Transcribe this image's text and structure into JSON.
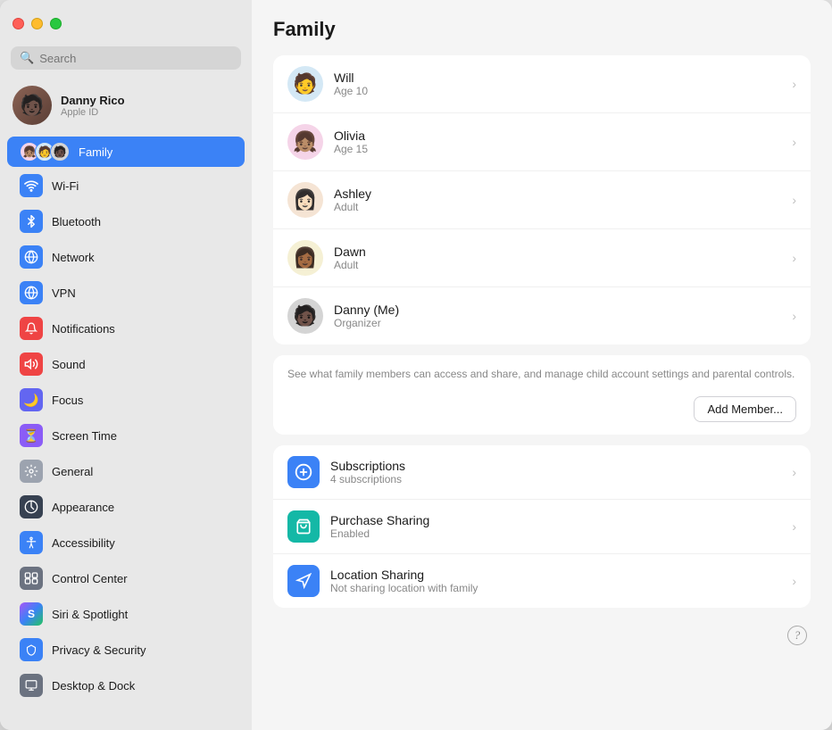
{
  "window": {
    "title": "Family"
  },
  "sidebar": {
    "search_placeholder": "Search",
    "user": {
      "name": "Danny Rico",
      "subtitle": "Apple ID",
      "emoji": "🧑🏿"
    },
    "items": [
      {
        "id": "family",
        "label": "Family",
        "icon": "family",
        "active": true
      },
      {
        "id": "wifi",
        "label": "Wi-Fi",
        "icon": "wifi"
      },
      {
        "id": "bluetooth",
        "label": "Bluetooth",
        "icon": "bluetooth"
      },
      {
        "id": "network",
        "label": "Network",
        "icon": "network"
      },
      {
        "id": "vpn",
        "label": "VPN",
        "icon": "vpn"
      },
      {
        "id": "notifications",
        "label": "Notifications",
        "icon": "notifications"
      },
      {
        "id": "sound",
        "label": "Sound",
        "icon": "sound"
      },
      {
        "id": "focus",
        "label": "Focus",
        "icon": "focus"
      },
      {
        "id": "screentime",
        "label": "Screen Time",
        "icon": "screentime"
      },
      {
        "id": "general",
        "label": "General",
        "icon": "general"
      },
      {
        "id": "appearance",
        "label": "Appearance",
        "icon": "appearance"
      },
      {
        "id": "accessibility",
        "label": "Accessibility",
        "icon": "accessibility"
      },
      {
        "id": "controlcenter",
        "label": "Control Center",
        "icon": "controlcenter"
      },
      {
        "id": "siri",
        "label": "Siri & Spotlight",
        "icon": "siri"
      },
      {
        "id": "privacy",
        "label": "Privacy & Security",
        "icon": "privacy"
      },
      {
        "id": "desktop",
        "label": "Desktop & Dock",
        "icon": "desktop"
      }
    ]
  },
  "main": {
    "title": "Family",
    "members": [
      {
        "name": "Will",
        "subtitle": "Age 10",
        "emoji": "🧑",
        "bg": "#d4e8f5"
      },
      {
        "name": "Olivia",
        "subtitle": "Age 15",
        "emoji": "👧🏽",
        "bg": "#f5d4e8"
      },
      {
        "name": "Ashley",
        "subtitle": "Adult",
        "emoji": "👩🏻",
        "bg": "#f5e4d4"
      },
      {
        "name": "Dawn",
        "subtitle": "Adult",
        "emoji": "👩🏾",
        "bg": "#f5f0d4"
      },
      {
        "name": "Danny (Me)",
        "subtitle": "Organizer",
        "emoji": "🧑🏿",
        "bg": "#d4d4d4"
      }
    ],
    "description": "See what family members can access and share, and manage child account settings and parental controls.",
    "add_member_label": "Add Member...",
    "services": [
      {
        "id": "subscriptions",
        "name": "Subscriptions",
        "subtitle": "4 subscriptions",
        "icon": "subscriptions"
      },
      {
        "id": "purchase",
        "name": "Purchase Sharing",
        "subtitle": "Enabled",
        "icon": "purchase"
      },
      {
        "id": "location",
        "name": "Location Sharing",
        "subtitle": "Not sharing location with family",
        "icon": "location"
      }
    ],
    "help_label": "?"
  }
}
